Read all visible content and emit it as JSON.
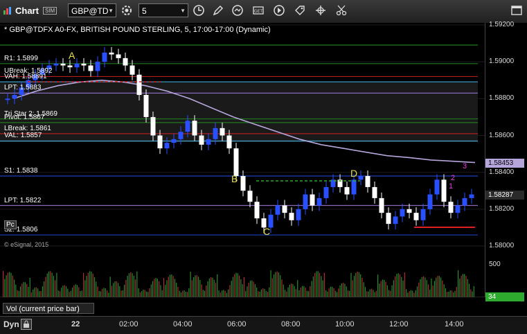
{
  "toolbar": {
    "title": "Chart",
    "sim_badge": "SIM",
    "symbol": "GBP@TD",
    "interval": "5"
  },
  "chart_header": "* GBP@TDFX A0-FX, BRITISH POUND STERLING, 5, 17:00-17:00 (Dynamic)",
  "levels": [
    {
      "label": "R1: 1.5899",
      "price": 1.5899,
      "color": "#1f7a1f"
    },
    {
      "label": "UBreak: 1.5892",
      "price": 1.5892,
      "color": "#b02020"
    },
    {
      "label": "VAH: 1.58891",
      "price": 1.58891,
      "color": "#3aa0c8"
    },
    {
      "label": "LPT: 1.5883",
      "price": 1.5883,
      "color": "#8a6ab8"
    },
    {
      "label": "Tri Star 2: 1.5869",
      "price": 1.5869,
      "color": "#1f7a1f"
    },
    {
      "label": "Pivot: 1.5867",
      "price": 1.5867,
      "color": "#1f7a1f"
    },
    {
      "label": "LBreak: 1.5861",
      "price": 1.5861,
      "color": "#b02020"
    },
    {
      "label": "VAL: 1.5857",
      "price": 1.5857,
      "color": "#3aa0c8"
    },
    {
      "label": "S1: 1.5838",
      "price": 1.5838,
      "color": "#2040c0"
    },
    {
      "label": "LPT: 1.5822",
      "price": 1.5822,
      "color": "#8a6ab8"
    },
    {
      "label": "S2: 1.5806",
      "price": 1.5806,
      "color": "#2040c0"
    }
  ],
  "price_axis": [
    "1.59200",
    "1.59000",
    "1.58800",
    "1.58600",
    "1.58400",
    "1.58200",
    "1.58000"
  ],
  "price_tags": [
    {
      "text": "1.58453",
      "bg": "#b7a6dc",
      "fg": "#000"
    },
    {
      "text": "1.58287",
      "bg": "#2a2a2a",
      "fg": "#fff"
    }
  ],
  "volume_axis": "500",
  "volume_tag": "34",
  "volume_title": "Vol (current price bar)",
  "letters": [
    "A",
    "B",
    "C",
    "D"
  ],
  "counts": [
    "1",
    "2",
    "3"
  ],
  "watermark": "© eSignal, 2015",
  "pc_badge": "Pc",
  "bottom": {
    "dyn": "Dyn",
    "times": [
      "22",
      "02:00",
      "04:00",
      "06:00",
      "08:00",
      "10:00",
      "12:00",
      "14:00"
    ]
  },
  "colors": {
    "up_bar": "#2a4fff",
    "down_bar": "#ffffff",
    "ma_line": "#b7a6dc",
    "vol_up": "#2e8b2e",
    "vol_down": "#b03030",
    "letter": "#e6e04a",
    "count": "#e040e0"
  }
}
